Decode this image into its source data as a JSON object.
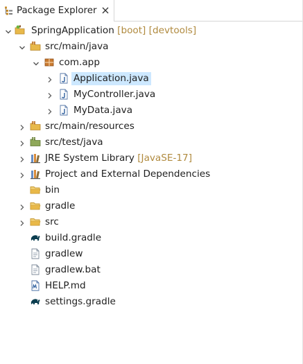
{
  "view": {
    "title": "Package Explorer",
    "tab_icon": "package-explorer-icon",
    "close_icon": "close-icon"
  },
  "project": {
    "name": "SpringApplication",
    "decoration": "[boot] [devtools]"
  },
  "tree": {
    "src_main_java": "src/main/java",
    "package": "com.app",
    "files": [
      "Application.java",
      "MyController.java",
      "MyData.java"
    ],
    "selected_file": "Application.java",
    "src_main_resources": "src/main/resources",
    "src_test_java": "src/test/java",
    "jre_label": "JRE System Library",
    "jre_decoration": "[JavaSE-17]",
    "dependencies": "Project and External Dependencies",
    "folders": [
      "bin",
      "gradle",
      "src"
    ],
    "build_gradle": "build.gradle",
    "gradlew": "gradlew",
    "gradlew_bat": "gradlew.bat",
    "help_md": "HELP.md",
    "settings_gradle": "settings.gradle"
  },
  "colors": {
    "selection": "#cde8ff",
    "decoration": "#b08a3e",
    "folder": "#e8b94a",
    "package": "#b5651d",
    "java_file": "#3b6db5",
    "gradle": "#0b3d4f"
  }
}
